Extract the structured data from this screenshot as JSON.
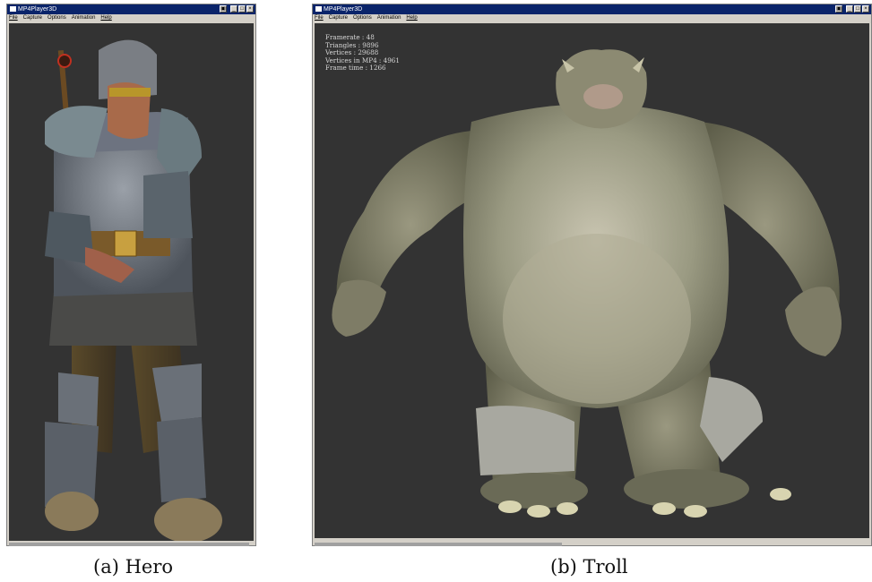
{
  "window_a": {
    "title": "MP4Player3D",
    "menu": [
      "File",
      "Capture",
      "Options",
      "Animation",
      "Help"
    ],
    "controls": [
      "restore-icon",
      "minimize-icon",
      "maximize-icon",
      "close-icon"
    ]
  },
  "window_b": {
    "title": "MP4Player3D",
    "menu": [
      "File",
      "Capture",
      "Options",
      "Animation",
      "Help"
    ],
    "stats": [
      "Framerate : 48",
      "Triangles : 9896",
      "Vertices : 29688",
      "Vertices in MP4 : 4961",
      "Frame time : 1266"
    ]
  },
  "captions": {
    "a": "(a) Hero",
    "b": "(b) Troll"
  },
  "colors": {
    "viewport_bg": "#333333",
    "titlebar_bg": "#0a246a",
    "window_bg": "#d4d0c8"
  }
}
